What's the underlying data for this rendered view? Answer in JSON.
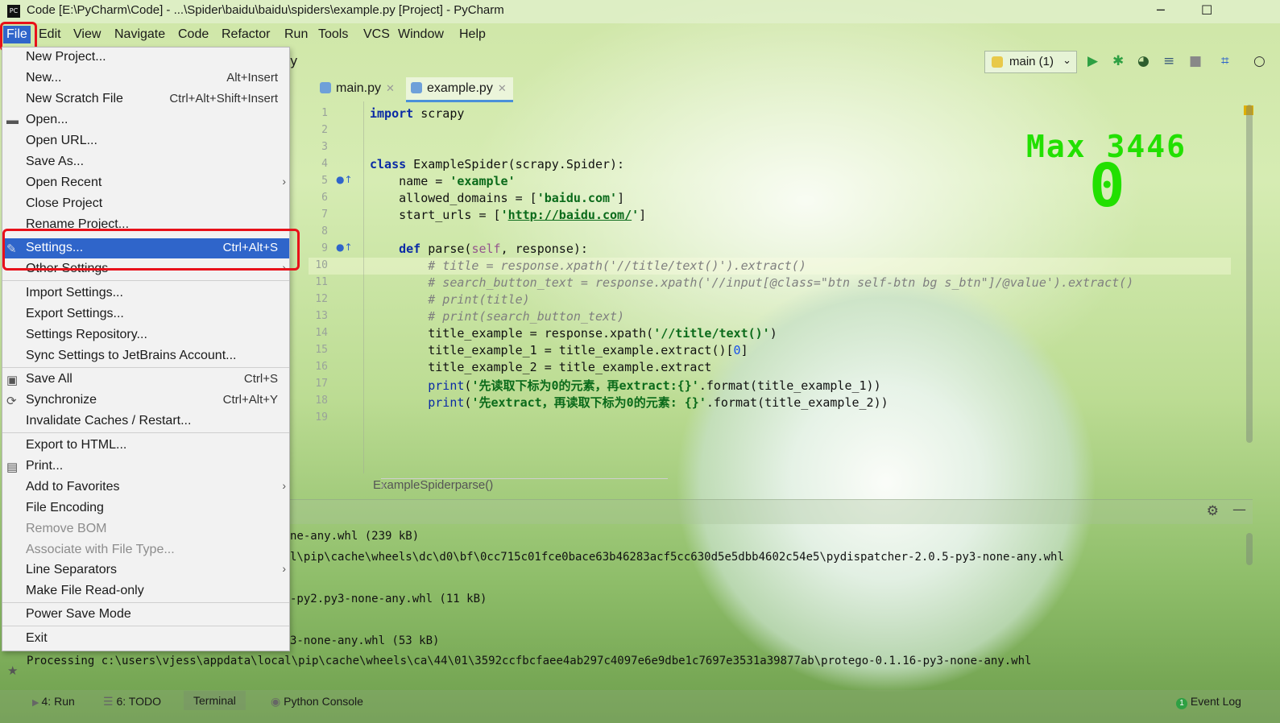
{
  "window": {
    "title": "Code [E:\\PyCharm\\Code] - ...\\Spider\\baidu\\baidu\\spiders\\example.py [Project] - PyCharm",
    "icon_label": "PC",
    "minimize": "─",
    "maximize": "☐"
  },
  "menubar": [
    "File",
    "Edit",
    "View",
    "Navigate",
    "Code",
    "Refactor",
    "Run",
    "Tools",
    "VCS",
    "Window",
    "Help"
  ],
  "toolbar": {
    "run_config": "main (1)",
    "breadcrumb_fragment": "y"
  },
  "tabs": [
    {
      "label": "main.py"
    },
    {
      "label": "example.py"
    }
  ],
  "editor": {
    "line_numbers": [
      "1",
      "2",
      "3",
      "4",
      "5",
      "6",
      "7",
      "8",
      "9",
      "10",
      "11",
      "12",
      "13",
      "14",
      "15",
      "16",
      "17",
      "18",
      "19"
    ],
    "overlay_max": "Max 3446",
    "overlay_zero": "0"
  },
  "breadcrumb": {
    "class": "ExampleSpider",
    "method": "parse()"
  },
  "console": {
    "lines": [
      "ne-any.whl (239 kB)",
      "l\\pip\\cache\\wheels\\dc\\d0\\bf\\0cc715c01fce0bace63b46283acf5cc630d5e5dbb4602c54e5\\pydispatcher-2.0.5-py3-none-any.whl",
      "-py2.py3-none-any.whl (11 kB)",
      "3-none-any.whl (53 kB)",
      "Processing c:\\users\\vjess\\appdata\\local\\pip\\cache\\wheels\\ca\\44\\01\\3592ccfbcfaee4ab297c4097e6e9dbe1c7697e3531a39877ab\\protego-0.1.16-py3-none-any.whl"
    ]
  },
  "bottombar": {
    "run": "4: Run",
    "todo": "6: TODO",
    "terminal": "Terminal",
    "python_console": "Python Console",
    "event_log": "Event Log",
    "event_count": "1"
  },
  "file_menu": {
    "new_project": "New Project...",
    "new": "New...",
    "new_sc": "Alt+Insert",
    "new_scratch": "New Scratch File",
    "new_scratch_sc": "Ctrl+Alt+Shift+Insert",
    "open": "Open...",
    "open_url": "Open URL...",
    "save_as": "Save As...",
    "open_recent": "Open Recent",
    "close_project": "Close Project",
    "rename_project": "Rename Project...",
    "settings": "Settings...",
    "settings_sc": "Ctrl+Alt+S",
    "other_settings": "Other Settings",
    "import_settings": "Import Settings...",
    "export_settings": "Export Settings...",
    "settings_repo": "Settings Repository...",
    "sync_settings": "Sync Settings to JetBrains Account...",
    "save_all": "Save All",
    "save_all_sc": "Ctrl+S",
    "synchronize": "Synchronize",
    "synchronize_sc": "Ctrl+Alt+Y",
    "invalidate": "Invalidate Caches / Restart...",
    "export_html": "Export to HTML...",
    "print": "Print...",
    "add_favorites": "Add to Favorites",
    "file_encoding": "File Encoding",
    "remove_bom": "Remove BOM",
    "associate": "Associate with File Type...",
    "line_sep": "Line Separators",
    "make_readonly": "Make File Read-only",
    "power_save": "Power Save Mode",
    "exit": "Exit"
  }
}
